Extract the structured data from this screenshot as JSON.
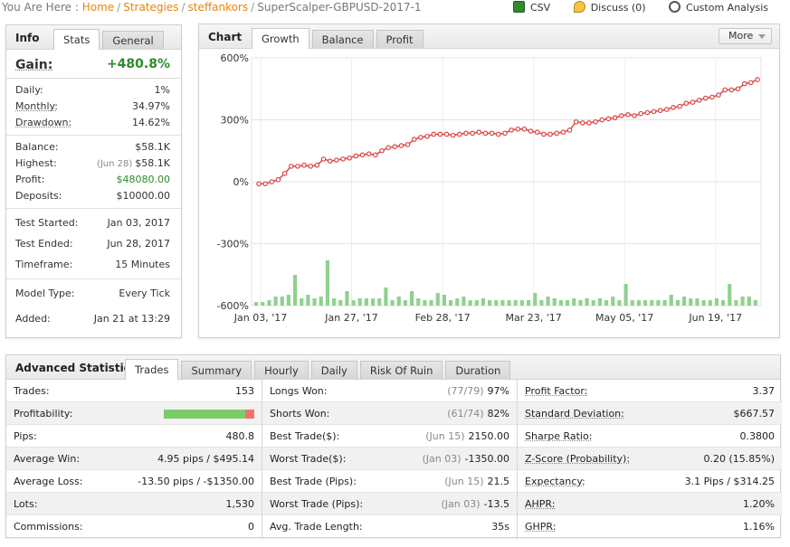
{
  "breadcrumb": {
    "prefix": "You Are Here :",
    "items": [
      "Home",
      "Strategies",
      "steffankors"
    ],
    "current": "SuperScalper-GBPUSD-2017-1"
  },
  "actions": {
    "csv": "CSV",
    "discuss": "Discuss (0)",
    "custom": "Custom Analysis"
  },
  "info": {
    "title": "Info",
    "tabs": [
      "Stats",
      "General"
    ],
    "gain_label": "Gain:",
    "gain_value": "+480.8%",
    "rows_returns": [
      {
        "label": "Daily:",
        "value": "1%"
      },
      {
        "label": "Monthly:",
        "value": "34.97%"
      },
      {
        "label": "Drawdown:",
        "value": "14.62%"
      }
    ],
    "rows_balance": [
      {
        "label": "Balance:",
        "value": "$58.1K"
      },
      {
        "label": "Highest:",
        "sub": "(Jun 28)",
        "value": "$58.1K"
      },
      {
        "label": "Profit:",
        "value": "$48080.00"
      },
      {
        "label": "Deposits:",
        "value": "$10000.00"
      }
    ],
    "rows_test": [
      {
        "label": "Test Started:",
        "value": "Jan 03, 2017"
      },
      {
        "label": "Test Ended:",
        "value": "Jun 28, 2017"
      },
      {
        "label": "Timeframe:",
        "value": "15 Minutes"
      }
    ],
    "rows_model": [
      {
        "label": "Model Type:",
        "value": "Every Tick"
      },
      {
        "label": "Added:",
        "value": "Jan 21 at 13:29"
      }
    ]
  },
  "chart_panel": {
    "title": "Chart",
    "tabs": [
      "Growth",
      "Balance",
      "Profit"
    ],
    "more": "More"
  },
  "chart_data": {
    "type": "line",
    "y_ticks": [
      "600%",
      "300%",
      "0%",
      "-300%",
      "-600%"
    ],
    "ylim": [
      -600,
      600
    ],
    "x_tick_labels": [
      "Jan 03, '17",
      "Jan 27, '17",
      "Feb 28, '17",
      "Mar 23, '17",
      "May 05, '17",
      "Jun 19, '17"
    ],
    "series": [
      {
        "color": "#dd4444",
        "values": [
          -10,
          -10,
          0,
          10,
          40,
          75,
          75,
          80,
          75,
          80,
          110,
          100,
          105,
          110,
          115,
          125,
          130,
          135,
          130,
          150,
          165,
          170,
          175,
          180,
          205,
          215,
          220,
          230,
          230,
          230,
          225,
          230,
          235,
          235,
          240,
          235,
          235,
          230,
          235,
          250,
          255,
          255,
          245,
          240,
          230,
          230,
          235,
          240,
          250,
          290,
          285,
          285,
          290,
          300,
          305,
          310,
          320,
          325,
          320,
          330,
          335,
          340,
          345,
          350,
          360,
          365,
          380,
          385,
          395,
          405,
          410,
          420,
          445,
          445,
          450,
          475,
          480,
          495
        ]
      }
    ],
    "volume": {
      "color": "#8fd18f",
      "values": [
        2,
        2,
        3,
        5,
        5,
        6,
        17,
        4,
        6,
        4,
        5,
        25,
        4,
        3,
        8,
        3,
        4,
        4,
        4,
        4,
        10,
        3,
        5,
        3,
        8,
        4,
        3,
        3,
        7,
        6,
        3,
        4,
        5,
        3,
        3,
        4,
        3,
        3,
        3,
        3,
        3,
        3,
        3,
        7,
        3,
        5,
        4,
        3,
        3,
        4,
        3,
        4,
        3,
        4,
        3,
        5,
        3,
        12,
        3,
        3,
        3,
        3,
        3,
        3,
        6,
        3,
        5,
        4,
        4,
        3,
        3,
        4,
        3,
        12,
        3,
        5,
        5,
        3
      ]
    }
  },
  "advanced": {
    "title": "Advanced Statistics",
    "tabs": [
      "Trades",
      "Summary",
      "Hourly",
      "Daily",
      "Risk Of Ruin",
      "Duration"
    ],
    "col1": [
      {
        "label": "Trades:",
        "value": "153"
      },
      {
        "label": "Profitability:",
        "type": "bar",
        "profit_fraction": 0.9
      },
      {
        "label": "Pips:",
        "value": "480.8"
      },
      {
        "label": "Average Win:",
        "value": "4.95 pips / $495.14"
      },
      {
        "label": "Average Loss:",
        "value": "-13.50 pips / -$1350.00"
      },
      {
        "label": "Lots:",
        "value": "1,530"
      },
      {
        "label": "Commissions:",
        "value": "0"
      }
    ],
    "col2": [
      {
        "label": "Longs Won:",
        "sub": "(77/79)",
        "value": "97%"
      },
      {
        "label": "Shorts Won:",
        "sub": "(61/74)",
        "value": "82%"
      },
      {
        "label": "Best Trade($):",
        "sub": "(Jun 15)",
        "value": "2150.00"
      },
      {
        "label": "Worst Trade($):",
        "sub": "(Jan 03)",
        "value": "-1350.00"
      },
      {
        "label": "Best Trade (Pips):",
        "sub": "(Jun 15)",
        "value": "21.5"
      },
      {
        "label": "Worst Trade (Pips):",
        "sub": "(Jan 03)",
        "value": "-13.5"
      },
      {
        "label": "Avg. Trade Length:",
        "value": "35s"
      }
    ],
    "col3": [
      {
        "label": "Profit Factor:",
        "value": "3.37"
      },
      {
        "label": "Standard Deviation:",
        "value": "$667.57"
      },
      {
        "label": "Sharpe Ratio:",
        "value": "0.3800"
      },
      {
        "label": "Z-Score (Probability):",
        "value": "0.20 (15.85%)"
      },
      {
        "label": "Expectancy:",
        "value": "3.1 Pips / $314.25"
      },
      {
        "label": "AHPR:",
        "value": "1.20%"
      },
      {
        "label": "GHPR:",
        "value": "1.16%"
      }
    ]
  }
}
